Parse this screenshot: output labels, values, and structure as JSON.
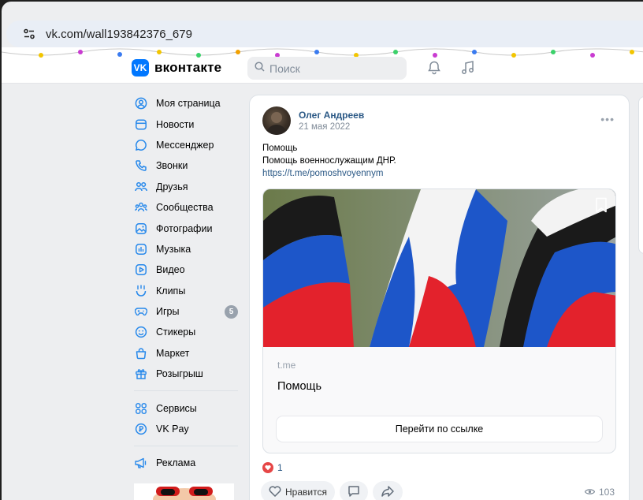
{
  "browser": {
    "url": "vk.com/wall193842376_679"
  },
  "header": {
    "logo_mark": "VK",
    "logo_text": "вконтакте",
    "search_placeholder": "Поиск"
  },
  "sidebar": {
    "items": [
      {
        "label": "Моя страница",
        "icon": "user-circle-icon"
      },
      {
        "label": "Новости",
        "icon": "news-icon"
      },
      {
        "label": "Мессенджер",
        "icon": "chat-bubble-icon"
      },
      {
        "label": "Звонки",
        "icon": "phone-icon"
      },
      {
        "label": "Друзья",
        "icon": "friends-icon"
      },
      {
        "label": "Сообщества",
        "icon": "communities-icon"
      },
      {
        "label": "Фотографии",
        "icon": "photo-icon"
      },
      {
        "label": "Музыка",
        "icon": "music-icon"
      },
      {
        "label": "Видео",
        "icon": "video-icon"
      },
      {
        "label": "Клипы",
        "icon": "clips-icon"
      },
      {
        "label": "Игры",
        "icon": "gamepad-icon",
        "badge": "5"
      },
      {
        "label": "Стикеры",
        "icon": "smile-icon"
      },
      {
        "label": "Маркет",
        "icon": "bag-icon"
      },
      {
        "label": "Розыгрыш",
        "icon": "gift-icon"
      }
    ],
    "items2": [
      {
        "label": "Сервисы",
        "icon": "services-icon"
      },
      {
        "label": "VK Pay",
        "icon": "vkpay-icon"
      }
    ],
    "items3": [
      {
        "label": "Реклама",
        "icon": "megaphone-icon"
      }
    ]
  },
  "post": {
    "author": "Олег Андреев",
    "date": "21 мая 2022",
    "text_line1": "Помощь",
    "text_line2": "Помощь военнослужащим ДНР.",
    "link": "https://t.me/pomoshvoyennym",
    "attachment": {
      "domain": "t.me",
      "title": "Помощь",
      "button": "Перейти по ссылке"
    },
    "reactions_count": "1",
    "like_label": "Нравится",
    "views": "103"
  },
  "colors": {
    "accent": "#0077ff",
    "link": "#2a5885",
    "background": "#edeef0"
  }
}
